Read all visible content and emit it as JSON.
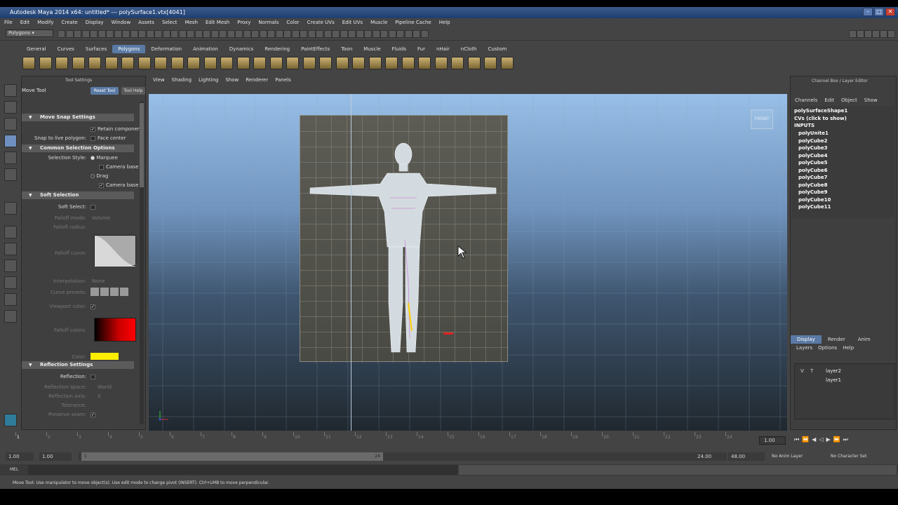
{
  "title": "Autodesk Maya 2014 x64: untitled* --- polySurface1.vtx[4041]",
  "menus": [
    "File",
    "Edit",
    "Modify",
    "Create",
    "Display",
    "Window",
    "Assets",
    "Select",
    "Mesh",
    "Edit Mesh",
    "Proxy",
    "Normals",
    "Color",
    "Create UVs",
    "Edit UVs",
    "Muscle",
    "Pipeline Cache",
    "Help"
  ],
  "mode_select": "Polygons",
  "shelf_tabs": [
    "General",
    "Curves",
    "Surfaces",
    "Polygons",
    "Deformation",
    "Animation",
    "Dynamics",
    "Rendering",
    "PaintEffects",
    "Toon",
    "Muscle",
    "Fluids",
    "Fur",
    "nHair",
    "nCloth",
    "Custom"
  ],
  "active_shelf_tab": "Polygons",
  "tool_panel": {
    "header": "Tool Settings",
    "tool_name": "Move Tool",
    "reset_label": "Reset Tool",
    "help_label": "Tool Help",
    "sections": {
      "move_snap": "Move Snap Settings",
      "common_selection": "Common Selection Options",
      "soft_selection": "Soft Selection",
      "reflection": "Reflection Settings"
    },
    "retain_label": "Retain componen",
    "snap_label": "Snap to live polygon:",
    "face_center_label": "Face center",
    "selection_style_label": "Selection Style:",
    "marquee_label": "Marquee",
    "camera_based_label": "Camera base",
    "drag_label": "Drag",
    "soft_select_label": "Soft Select:",
    "falloff_mode_label": "Falloff mode:",
    "falloff_mode_value": "Volume",
    "falloff_radius_label": "Falloff radius:",
    "falloff_curve_label": "Falloff curve:",
    "interpolation_label": "Interpolation:",
    "interpolation_value": "None",
    "curve_presets_label": "Curve presets:",
    "viewport_color_label": "Viewport color:",
    "falloff_colors_label": "Falloff colors:",
    "color_label": "Color:",
    "reflection_label": "Reflection:",
    "reflection_space_label": "Reflection space:",
    "reflection_space_value": "World",
    "reflection_axis_label": "Reflection Axis:",
    "reflection_axis_value": "X",
    "tolerance_label": "Tolerance:",
    "preserve_label": "Preserve seam:"
  },
  "viewport_menu": [
    "View",
    "Shading",
    "Lighting",
    "Show",
    "Renderer",
    "Panels"
  ],
  "viewport_label": "FRONT",
  "channel_box": {
    "header": "Channel Box / Layer Editor",
    "tabs": [
      "Channels",
      "Edit",
      "Object",
      "Show"
    ],
    "shape": "polySurfaceShape1",
    "cvs": "CVs (click to show)",
    "inputs_label": "INPUTS",
    "inputs": [
      "polyUnite1",
      "polyCube2",
      "polyCube3",
      "polyCube4",
      "polyCube5",
      "polyCube6",
      "polyCube7",
      "polyCube8",
      "polyCube9",
      "polyCube10",
      "polyCube11"
    ]
  },
  "layer_editor": {
    "tabs": [
      "Display",
      "Render",
      "Anim"
    ],
    "menus": [
      "Layers",
      "Options",
      "Help"
    ],
    "v_label": "V",
    "t_label": "T",
    "layers": [
      "layer2",
      "layer1"
    ]
  },
  "timeline": {
    "ticks": [
      "1",
      "2",
      "3",
      "4",
      "5",
      "6",
      "7",
      "8",
      "9",
      "10",
      "11",
      "12",
      "13",
      "14",
      "15",
      "16",
      "17",
      "18",
      "19",
      "20",
      "21",
      "22",
      "23",
      "24"
    ],
    "current_frame": "1.00"
  },
  "range": {
    "start": "1.00",
    "playback_start": "1.00",
    "range_start_marker": "1",
    "range_end_marker": "24",
    "playback_end": "24.00",
    "end": "48.00",
    "anim_layer": "No Anim Layer",
    "char_set": "No Character Set"
  },
  "command_line_label": "MEL",
  "help_line": "Move Tool: Use manipulator to move object(s). Use edit mode to change pivot (INSERT). Ctrl+LMB to move perpendicular.",
  "colors": {
    "accent": "#5a7aa5",
    "viewport_top": "#98bfe7",
    "viewport_bottom": "#20282f"
  }
}
